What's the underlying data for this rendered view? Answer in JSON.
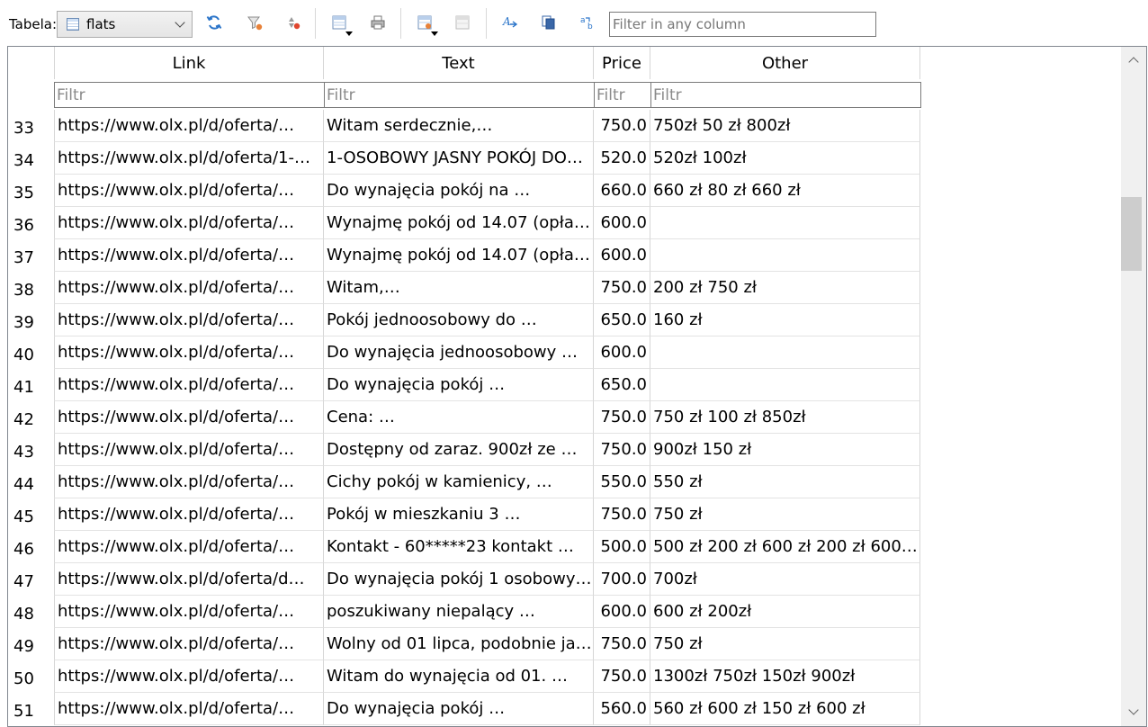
{
  "toolbar": {
    "table_label": "Tabela:",
    "table_select_value": "flats",
    "buttons": [
      {
        "name": "refresh-button",
        "icon": "refresh-icon"
      },
      {
        "name": "clear-filters-button",
        "icon": "clear-filter-icon"
      },
      {
        "name": "clear-sort-button",
        "icon": "clear-sort-icon"
      },
      {
        "name": "save-table-button",
        "icon": "save-table-icon"
      },
      {
        "name": "print-button",
        "icon": "printer-icon"
      },
      {
        "name": "new-record-button",
        "icon": "new-record-icon"
      },
      {
        "name": "delete-record-button",
        "icon": "delete-record-icon"
      },
      {
        "name": "find-button",
        "icon": "find-text-icon"
      },
      {
        "name": "copy-button",
        "icon": "copy-icon"
      },
      {
        "name": "replace-button",
        "icon": "replace-text-icon"
      }
    ],
    "filter_placeholder": "Filter in any column"
  },
  "grid": {
    "columns": [
      {
        "key": "link",
        "label": "Link"
      },
      {
        "key": "text",
        "label": "Text"
      },
      {
        "key": "price",
        "label": "Price"
      },
      {
        "key": "other",
        "label": "Other"
      }
    ],
    "filter_placeholder": "Filtr",
    "rows": [
      {
        "n": "33",
        "link": "https://www.olx.pl/d/oferta/…",
        "text": "Witam serdecznie,…",
        "price": "750.0",
        "other": "750zł 50 zł 800zł"
      },
      {
        "n": "34",
        "link": "https://www.olx.pl/d/oferta/1-…",
        "text": "1-OSOBOWY JASNY POKÓJ DO…",
        "price": "520.0",
        "other": "520zł 100zł"
      },
      {
        "n": "35",
        "link": "https://www.olx.pl/d/oferta/…",
        "text": "Do wynajęcia pokój na …",
        "price": "660.0",
        "other": "660 zł 80 zł 660 zł"
      },
      {
        "n": "36",
        "link": "https://www.olx.pl/d/oferta/…",
        "text": "Wynajmę pokój od 14.07 (opła…",
        "price": "600.0",
        "other": ""
      },
      {
        "n": "37",
        "link": "https://www.olx.pl/d/oferta/…",
        "text": "Wynajmę pokój od 14.07 (opła…",
        "price": "600.0",
        "other": ""
      },
      {
        "n": "38",
        "link": "https://www.olx.pl/d/oferta/…",
        "text": "Witam,…",
        "price": "750.0",
        "other": "200 zł 750 zł"
      },
      {
        "n": "39",
        "link": "https://www.olx.pl/d/oferta/…",
        "text": "Pokój jednoosobowy do …",
        "price": "650.0",
        "other": "160 zł"
      },
      {
        "n": "40",
        "link": "https://www.olx.pl/d/oferta/…",
        "text": "Do wynajęcia jednoosobowy …",
        "price": "600.0",
        "other": ""
      },
      {
        "n": "41",
        "link": "https://www.olx.pl/d/oferta/…",
        "text": "Do wynajęcia pokój …",
        "price": "650.0",
        "other": ""
      },
      {
        "n": "42",
        "link": "https://www.olx.pl/d/oferta/…",
        "text": "Cena: …",
        "price": "750.0",
        "other": "750 zł 100 zł 850zł"
      },
      {
        "n": "43",
        "link": "https://www.olx.pl/d/oferta/…",
        "text": "Dostępny od zaraz. 900zł ze …",
        "price": "750.0",
        "other": "900zł 150 zł"
      },
      {
        "n": "44",
        "link": "https://www.olx.pl/d/oferta/…",
        "text": "Cichy pokój w kamienicy, …",
        "price": "550.0",
        "other": "550 zł"
      },
      {
        "n": "45",
        "link": "https://www.olx.pl/d/oferta/…",
        "text": "Pokój w mieszkaniu 3 …",
        "price": "750.0",
        "other": "750 zł"
      },
      {
        "n": "46",
        "link": "https://www.olx.pl/d/oferta/…",
        "text": "Kontakt - 60*****23 kontakt …",
        "price": "500.0",
        "other": "500 zł 200 zł 600 zł 200 zł 600…"
      },
      {
        "n": "47",
        "link": "https://www.olx.pl/d/oferta/d…",
        "text": "Do wynajęcia pokój 1 osobowy…",
        "price": "700.0",
        "other": "700zł"
      },
      {
        "n": "48",
        "link": "https://www.olx.pl/d/oferta/…",
        "text": "poszukiwany niepalący …",
        "price": "600.0",
        "other": "600 zł 200zł"
      },
      {
        "n": "49",
        "link": "https://www.olx.pl/d/oferta/…",
        "text": "Wolny od 01 lipca, podobnie ja…",
        "price": "750.0",
        "other": "750 zł"
      },
      {
        "n": "50",
        "link": "https://www.olx.pl/d/oferta/…",
        "text": "Witam do wynajęcia od 01. …",
        "price": "750.0",
        "other": "1300zł 750zł 150zł 900zł"
      },
      {
        "n": "51",
        "link": "https://www.olx.pl/d/oferta/…",
        "text": "Do wynajęcia pokój …",
        "price": "560.0",
        "other": "560 zł 600 zł 150 zł 600 zł"
      }
    ]
  }
}
